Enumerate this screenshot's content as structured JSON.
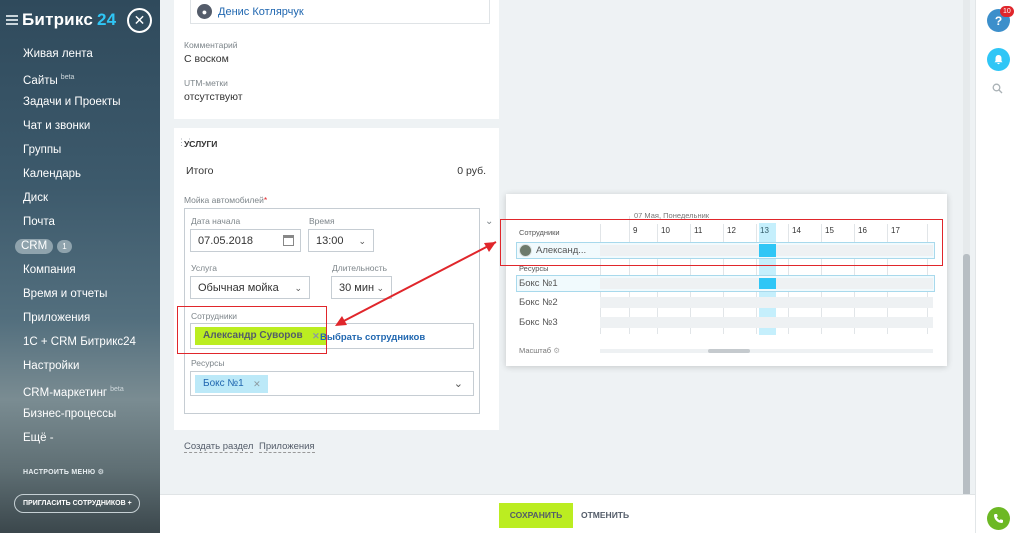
{
  "sidebar": {
    "logo_main": "Битрикс",
    "logo_num": "24",
    "items": [
      {
        "label": "Живая лента"
      },
      {
        "label": "Сайты",
        "sup": "beta"
      },
      {
        "label": "Задачи и Проекты"
      },
      {
        "label": "Чат и звонки"
      },
      {
        "label": "Группы"
      },
      {
        "label": "Календарь"
      },
      {
        "label": "Диск"
      },
      {
        "label": "Почта"
      },
      {
        "label": "CRM",
        "count": "1"
      },
      {
        "label": "Компания"
      },
      {
        "label": "Время и отчеты"
      },
      {
        "label": "Приложения"
      },
      {
        "label": "1С + CRM Битрикс24"
      },
      {
        "label": "Настройки"
      },
      {
        "label": "CRM-маркетинг",
        "sup": "beta"
      },
      {
        "label": "Бизнес-процессы"
      },
      {
        "label": "Ещё -"
      }
    ],
    "settings_label": "НАСТРОИТЬ МЕНЮ",
    "invite_label": "ПРИГЛАСИТЬ СОТРУДНИКОВ"
  },
  "deal": {
    "responsible_name": "Денис Котлярчук",
    "comment_label": "Комментарий",
    "comment_value": "С воском",
    "utm_label": "UTM-метки",
    "utm_value": "отсутствуют"
  },
  "services": {
    "title": "УСЛУГИ",
    "total_label": "Итого",
    "total_value": "0 руб.",
    "booking_label": "Мойка автомобилей",
    "start_date_label": "Дата начала",
    "start_date_value": "07.05.2018",
    "time_label": "Время",
    "time_value": "13:00",
    "service_label": "Услуга",
    "service_value": "Обычная мойка",
    "duration_label": "Длительность",
    "duration_value": "30 мин",
    "staff_label": "Сотрудники",
    "staff_tag": "Александр Суворов",
    "choose_staff": "Выбрать сотрудников",
    "resources_label": "Ресурсы",
    "resource_tag": "Бокс №1",
    "create_section": "Создать раздел",
    "apps_link": "Приложения"
  },
  "scheduler": {
    "date_header": "07 Мая, Понедельник",
    "staff_header": "Сотрудники",
    "staff_name": "Александ...",
    "resources_header": "Ресурсы",
    "resources": [
      "Бокс №1",
      "Бокс №2",
      "Бокс №3"
    ],
    "hours": [
      "9",
      "10",
      "11",
      "12",
      "13",
      "14",
      "15",
      "16",
      "17"
    ],
    "scale_label": "Масштаб"
  },
  "rightbar": {
    "help_badge": "10"
  },
  "footer": {
    "save_label": "СОХРАНИТЬ",
    "cancel_label": "ОТМЕНИТЬ"
  },
  "colors": {
    "accent_green": "#bbed21",
    "highlight_red": "#e0262b",
    "link_blue": "#2067b0",
    "timeline_selection": "#2fc6f6"
  }
}
